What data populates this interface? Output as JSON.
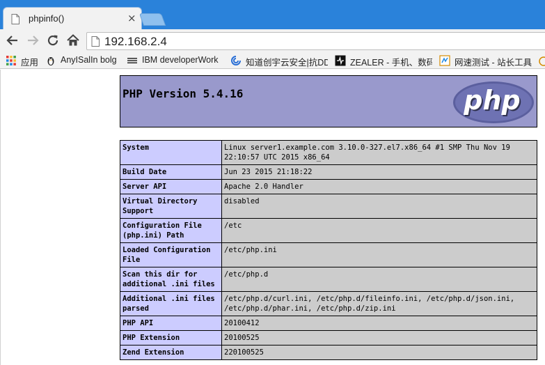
{
  "browser": {
    "tab": {
      "title": "phpinfo()",
      "close": "×"
    },
    "url": "192.168.2.4",
    "bookmarks": [
      {
        "icon": "apps-icon",
        "label": "应用"
      },
      {
        "icon": "penguin-icon",
        "label": "AnyISalIn bolg"
      },
      {
        "icon": "ibm-icon",
        "label": "IBM developerWork"
      },
      {
        "icon": "knownsec-icon",
        "label": "知道创宇云安全|抗DD"
      },
      {
        "icon": "zealer-icon",
        "label": "ZEALER - 手机、数码"
      },
      {
        "icon": "speedtest-icon",
        "label": "网速测试 - 站长工具"
      }
    ]
  },
  "phpinfo": {
    "version_title": "PHP Version 5.4.16",
    "logo_text": "php",
    "rows": [
      {
        "key": "System",
        "value": "Linux server1.example.com 3.10.0-327.el7.x86_64 #1 SMP Thu Nov 19 22:10:57 UTC 2015 x86_64"
      },
      {
        "key": "Build Date",
        "value": "Jun 23 2015 21:18:22"
      },
      {
        "key": "Server API",
        "value": "Apache 2.0 Handler"
      },
      {
        "key": "Virtual Directory Support",
        "value": "disabled"
      },
      {
        "key": "Configuration File (php.ini) Path",
        "value": "/etc"
      },
      {
        "key": "Loaded Configuration File",
        "value": "/etc/php.ini"
      },
      {
        "key": "Scan this dir for additional .ini files",
        "value": "/etc/php.d"
      },
      {
        "key": "Additional .ini files parsed",
        "value": "/etc/php.d/curl.ini, /etc/php.d/fileinfo.ini, /etc/php.d/json.ini, /etc/php.d/phar.ini, /etc/php.d/zip.ini"
      },
      {
        "key": "PHP API",
        "value": "20100412"
      },
      {
        "key": "PHP Extension",
        "value": "20100525"
      },
      {
        "key": "Zend Extension",
        "value": "220100525"
      }
    ]
  }
}
